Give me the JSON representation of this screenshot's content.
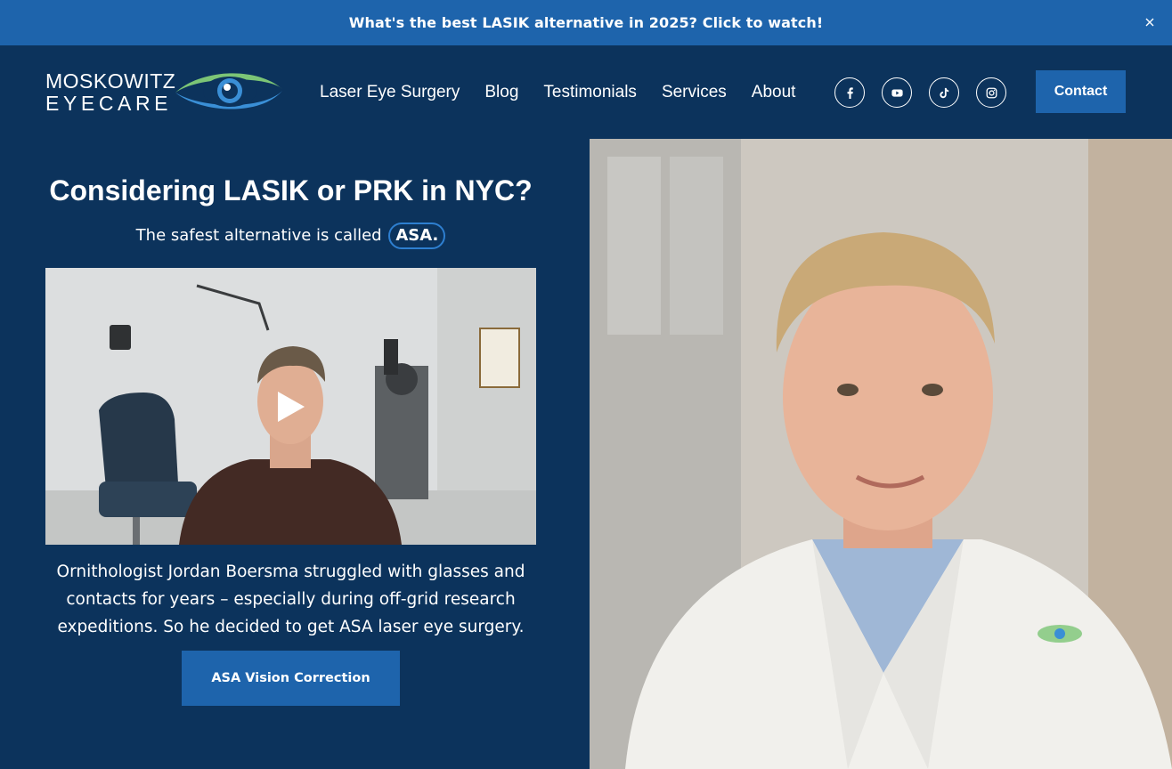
{
  "announcement": {
    "text": "What's the best LASIK alternative in 2025? Click to watch!"
  },
  "logo": {
    "line1": "MOSKOWITZ",
    "line2": "EYECARE"
  },
  "nav": {
    "items": [
      {
        "label": "Laser Eye Surgery"
      },
      {
        "label": "Blog"
      },
      {
        "label": "Testimonials"
      },
      {
        "label": "Services"
      },
      {
        "label": "About"
      }
    ]
  },
  "socials": [
    {
      "icon": "facebook-icon"
    },
    {
      "icon": "youtube-icon"
    },
    {
      "icon": "tiktok-icon"
    },
    {
      "icon": "instagram-icon"
    }
  ],
  "contact_label": "Contact",
  "hero": {
    "title_part1": "Considering ",
    "title_lasik": "LASIK",
    "title_or": " or ",
    "title_prk": "PRK",
    "title_part2": " in NYC?",
    "subtitle": "The safest alternative is called",
    "badge": "ASA."
  },
  "video": {
    "icon": "play-icon"
  },
  "caption": "Ornithologist Jordan Boersma struggled with glasses and contacts for years – especially during off-grid research expeditions. So he decided to get ASA laser eye surgery.",
  "cta_label": "ASA Vision Correction",
  "colors": {
    "background": "#0c335c",
    "accent": "#1e64ac",
    "logo_green": "#7cc576",
    "logo_blue": "#3a8fd6"
  }
}
